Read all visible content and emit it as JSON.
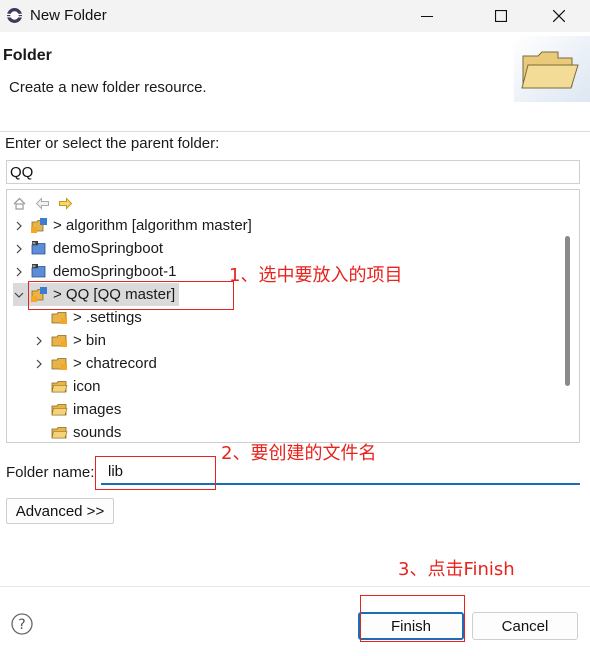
{
  "window": {
    "title": "New Folder",
    "controls": [
      "minimize-icon",
      "maximize-icon",
      "close-icon"
    ]
  },
  "header": {
    "title": "Folder",
    "description": "Create a new folder resource."
  },
  "parent": {
    "label": "Enter or select the parent folder:",
    "value": "QQ"
  },
  "tree": {
    "toolbar": [
      "home-icon",
      "back-icon",
      "forward-icon"
    ],
    "items": [
      {
        "label": "> algorithm [algorithm master]",
        "expander": "collapsed",
        "icon": "git-project-icon"
      },
      {
        "label": "demoSpringboot",
        "expander": "collapsed",
        "icon": "maven-project-icon"
      },
      {
        "label": "demoSpringboot-1",
        "expander": "collapsed",
        "icon": "maven-project-icon"
      },
      {
        "label": "> QQ [QQ master]",
        "expander": "expanded",
        "icon": "git-project-icon",
        "selected": true
      },
      {
        "label": "> .settings",
        "expander": "none",
        "icon": "folder-git-icon"
      },
      {
        "label": "> bin",
        "expander": "collapsed",
        "icon": "folder-git-icon"
      },
      {
        "label": "> chatrecord",
        "expander": "collapsed",
        "icon": "folder-git-icon"
      },
      {
        "label": "icon",
        "expander": "none",
        "icon": "folder-icon"
      },
      {
        "label": "images",
        "expander": "none",
        "icon": "folder-icon"
      },
      {
        "label": "sounds",
        "expander": "none",
        "icon": "folder-icon"
      }
    ]
  },
  "folder_name": {
    "label": "Folder name:",
    "value": "lib"
  },
  "buttons": {
    "advanced": "Advanced >>",
    "finish": "Finish",
    "cancel": "Cancel"
  },
  "annotations": {
    "step1": "1、选中要放入的项目",
    "step2": "2、要创建的文件名",
    "step3": "3、点击Finish",
    "color": "#e8231d"
  },
  "colors": {
    "accent": "#1c6db5",
    "folder": "#e8b44a"
  }
}
